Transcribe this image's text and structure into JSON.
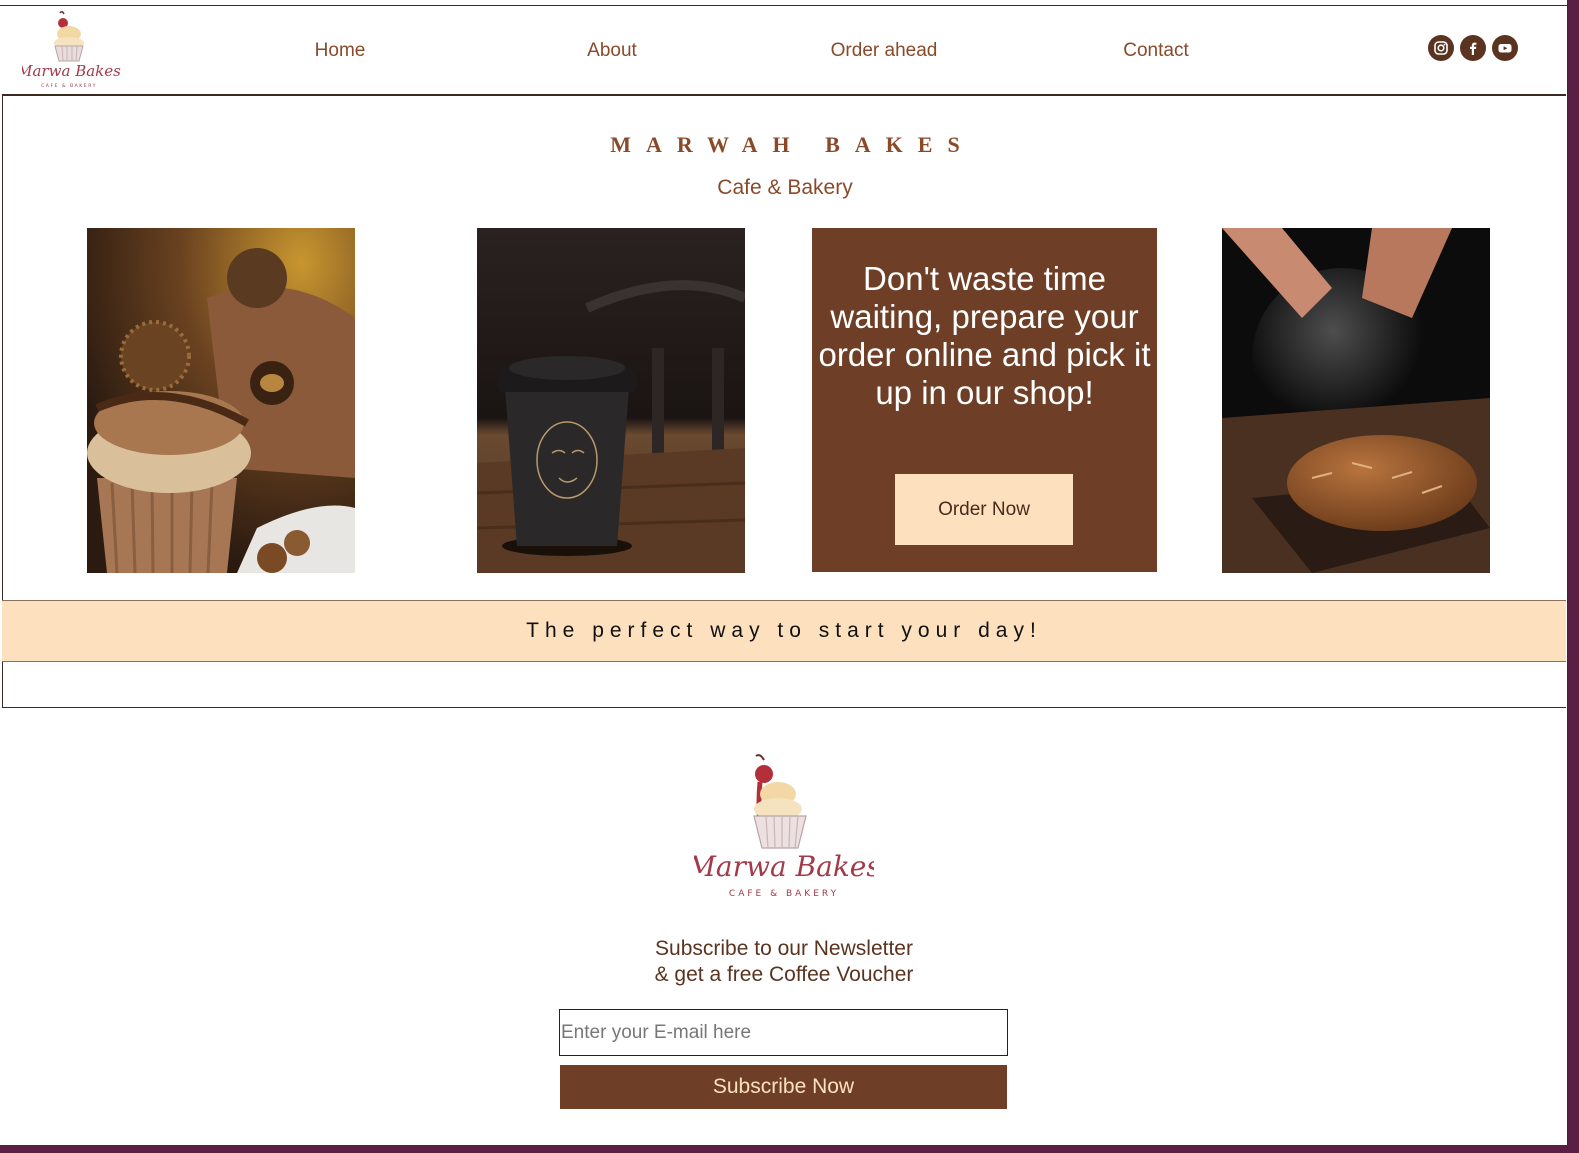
{
  "header": {
    "logo_script": "Marwa Bakes",
    "logo_sub": "CAFE & BAKERY",
    "nav": [
      "Home",
      "About",
      "Order ahead",
      "Contact"
    ],
    "social_icons": [
      "instagram-icon",
      "facebook-icon",
      "youtube-icon"
    ]
  },
  "hero": {
    "brand": "MARWAH BAKES",
    "tagline": "Cafe & Bakery",
    "photos": [
      "chocolate-cupcake-photo",
      "coffee-cup-photo",
      "bread-flour-photo"
    ],
    "promo_text": "Don't waste time waiting, prepare your order online and pick it up in our shop!",
    "order_button": "Order Now"
  },
  "band": {
    "text": "The perfect way to start your day!"
  },
  "footer": {
    "logo_script": "Marwa Bakes",
    "logo_sub": "CAFE & BAKERY",
    "newsletter_line1": "Subscribe to our Newsletter",
    "newsletter_line2": "& get a free Coffee Voucher",
    "email_placeholder": "Enter your E-mail here",
    "subscribe_button": "Subscribe Now"
  },
  "colors": {
    "brown": "#6e3f26",
    "cream": "#fde1bf",
    "link": "#8a4a2a",
    "logo_text": "#a33a4a",
    "outer_background": "#5a1f45"
  }
}
